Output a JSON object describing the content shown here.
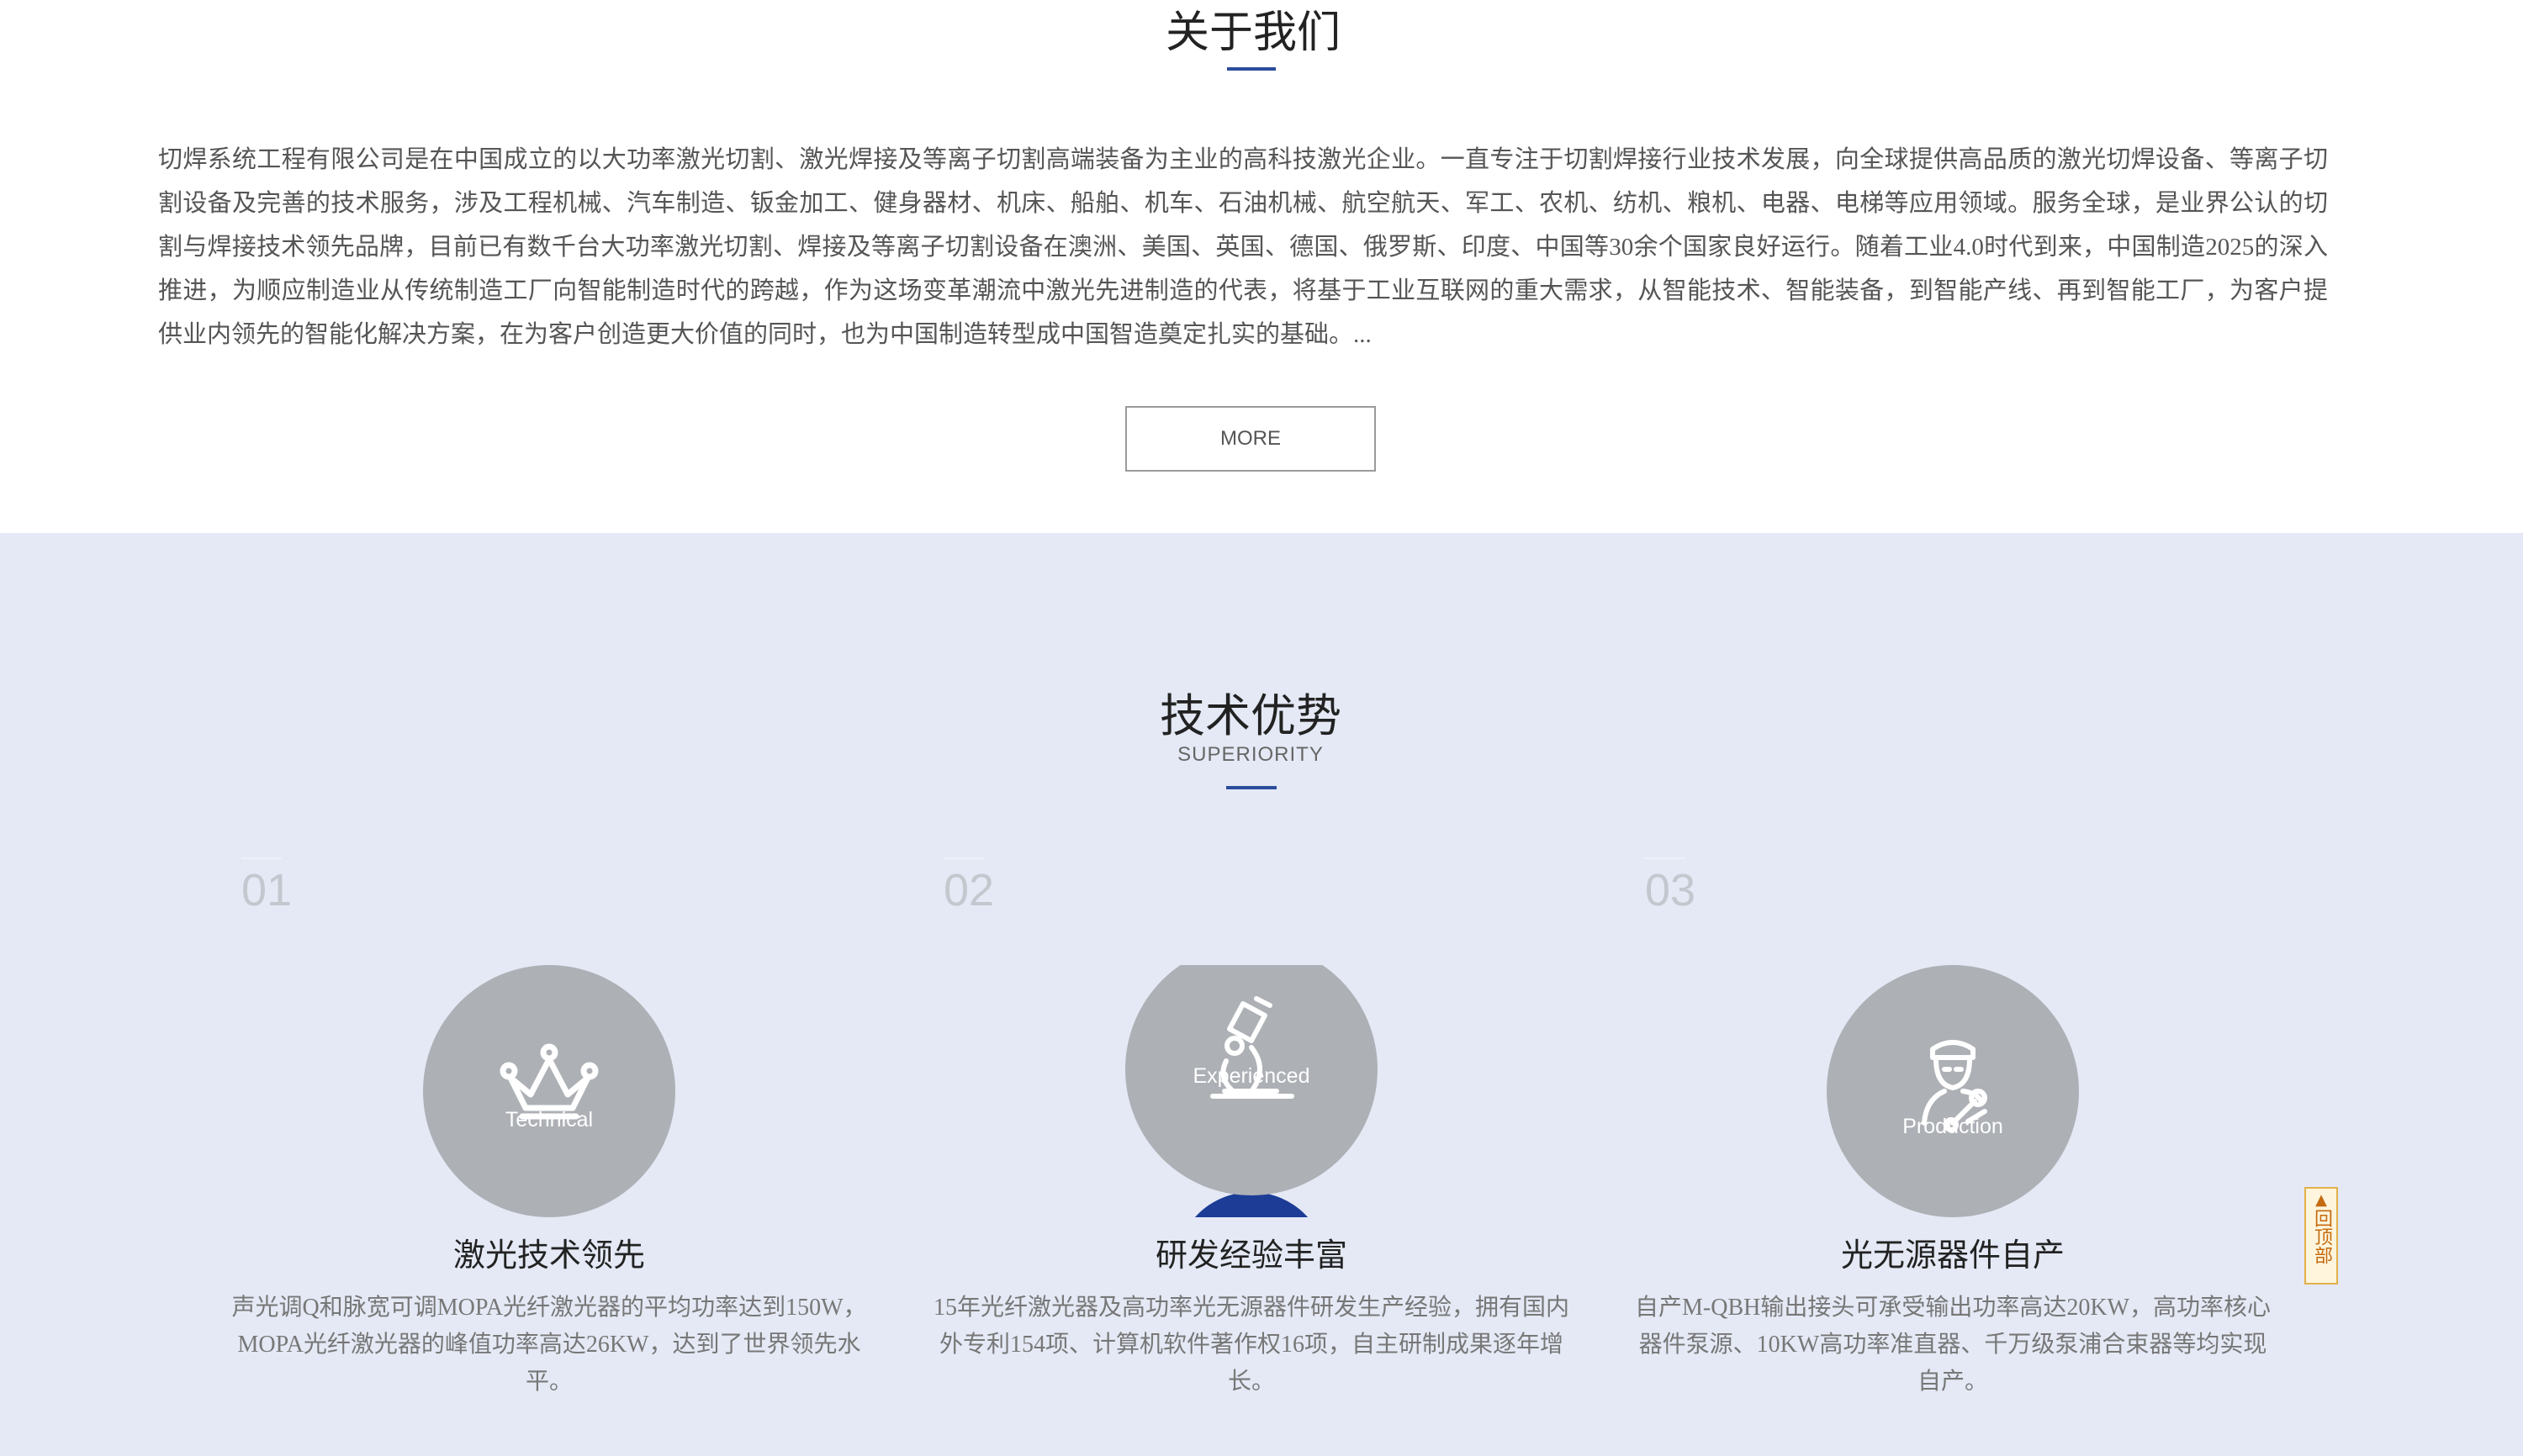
{
  "about": {
    "title": "关于我们",
    "text": "切焊系统工程有限公司是在中国成立的以大功率激光切割、激光焊接及等离子切割高端装备为主业的高科技激光企业。一直专注于切割焊接行业技术发展，向全球提供高品质的激光切焊设备、等离子切割设备及完善的技术服务，涉及工程机械、汽车制造、钣金加工、健身器材、机床、船舶、机车、石油机械、航空航天、军工、农机、纺机、粮机、电器、电梯等应用领域。服务全球，是业界公认的切割与焊接技术领先品牌，目前已有数千台大功率激光切割、焊接及等离子切割设备在澳洲、美国、英国、德国、俄罗斯、印度、中国等30余个国家良好运行。随着工业4.0时代到来，中国制造2025的深入推进，为顺应制造业从传统制造工厂向智能制造时代的跨越，作为这场变革潮流中激光先进制造的代表，将基于工业互联网的重大需求，从智能技术、智能装备，到智能产线、再到智能工厂，为客户提供业内领先的智能化解决方案，在为客户创造更大价值的同时，也为中国制造转型成中国智造奠定扎实的基础。...",
    "more_label": "MORE"
  },
  "superiority": {
    "title": "技术优势",
    "subtitle": "SUPERIORITY",
    "cards": [
      {
        "num": "01",
        "icon": "crown-icon",
        "label": "Technical",
        "title": "激光技术领先",
        "desc": "声光调Q和脉宽可调MOPA光纤激光器的平均功率达到150W，MOPA光纤激光器的峰值功率高达26KW，达到了世界领先水平。"
      },
      {
        "num": "02",
        "icon": "microscope-icon",
        "label": "Experienced",
        "title": "研发经验丰富",
        "desc": "15年光纤激光器及高功率光无源器件研发生产经验，拥有国内外专利154项、计算机软件著作权16项，自主研制成果逐年增长。"
      },
      {
        "num": "03",
        "icon": "engineer-icon",
        "label": "Production",
        "title": "光无源器件自产",
        "desc": "自产M-QBH输出接头可承受输出功率高达20KW，高功率核心器件泵源、10KW高功率准直器、千万级泵浦合束器等均实现自产。"
      }
    ]
  },
  "back_top": {
    "arrow": "▲",
    "label": "回顶部"
  },
  "colors": {
    "accent": "#2b4d9b",
    "section_bg": "#e4e9f5",
    "circle": "#adb0b5",
    "active_arc": "#1c3c96"
  }
}
